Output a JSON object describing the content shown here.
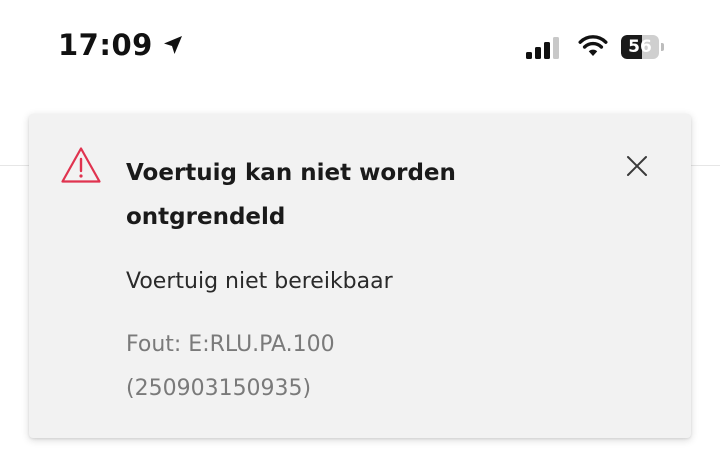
{
  "status_bar": {
    "time": "17:09",
    "battery_level": "56",
    "battery_fraction": 0.56,
    "icons": [
      "location-arrow-icon",
      "cellular-signal-icon",
      "wifi-icon",
      "battery-icon"
    ]
  },
  "toast": {
    "icon": "warning-triangle-icon",
    "title": "Voertuig kan niet worden ontgrendeld",
    "message": "Voertuig niet bereikbaar",
    "error_code": "Fout: E:RLU.PA.100",
    "error_id": "(250903150935)",
    "close_icon": "close-icon",
    "colors": {
      "warning": "#e0334f",
      "background": "#f2f2f2",
      "title": "#1a1a1a",
      "secondary": "#7a7a7a"
    }
  }
}
